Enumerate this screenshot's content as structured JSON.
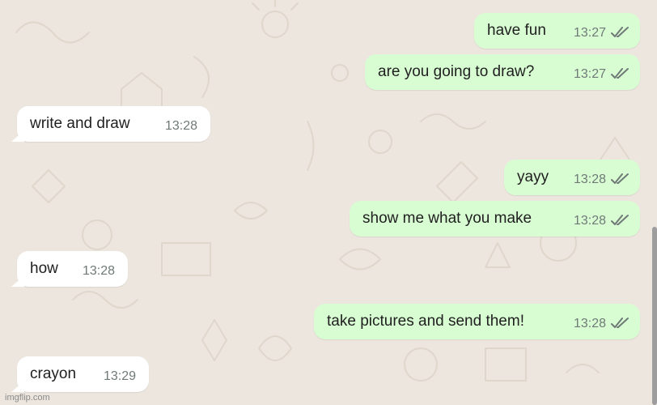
{
  "conversation": {
    "messages": [
      {
        "direction": "outgoing",
        "text": "have fun",
        "time": "13:27",
        "status_icon": "double-check-read-icon"
      },
      {
        "direction": "outgoing",
        "text": "are you going to draw?",
        "time": "13:27",
        "status_icon": "double-check-read-icon"
      },
      {
        "direction": "incoming",
        "text": "write and draw",
        "time": "13:28"
      },
      {
        "direction": "outgoing",
        "text": "yayy",
        "time": "13:28",
        "status_icon": "double-check-read-icon"
      },
      {
        "direction": "outgoing",
        "text": "show me what you make",
        "time": "13:28",
        "status_icon": "double-check-read-icon"
      },
      {
        "direction": "incoming",
        "text": "how",
        "time": "13:28"
      },
      {
        "direction": "outgoing",
        "text": "take pictures and send them!",
        "time": "13:28",
        "status_icon": "double-check-read-icon"
      },
      {
        "direction": "incoming",
        "text": "crayon",
        "time": "13:29"
      }
    ]
  },
  "colors": {
    "background": "#ECE6DE",
    "outgoing_bubble": "#D9FDD3",
    "incoming_bubble": "#FFFFFF",
    "timestamp": "#6F7A77",
    "ticks": "#6F7A77"
  },
  "watermark": "imgflip.com"
}
